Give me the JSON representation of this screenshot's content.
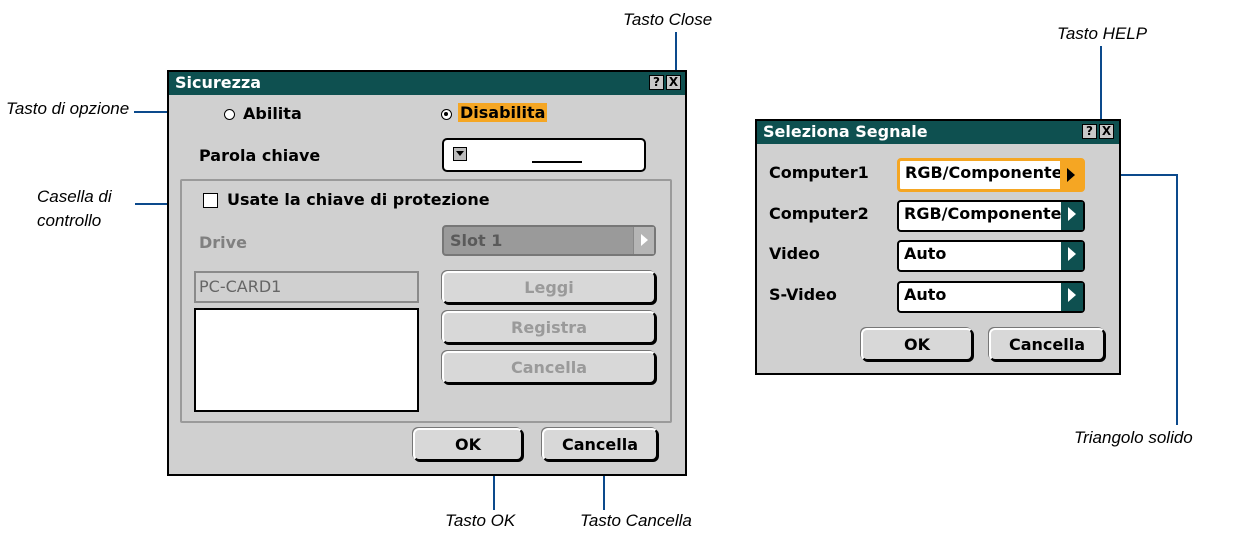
{
  "callouts": {
    "tasto_close": "Tasto Close",
    "tasto_help": "Tasto HELP",
    "tasto_opzione": "Tasto di opzione",
    "casella_line1": "Casella di",
    "casella_line2": "controllo",
    "triangolo": "Triangolo solido",
    "tasto_ok": "Tasto OK",
    "tasto_cancella": "Tasto Cancella"
  },
  "sicurezza": {
    "title": "Sicurezza",
    "help_glyph": "?",
    "close_glyph": "X",
    "radio_enable": "Abilita",
    "radio_disable": "Disabilita",
    "selected_radio": "Disabilita",
    "keyword_label": "Parola chiave",
    "keyword_value": "",
    "checkbox_label": "Usate la chiave di protezione",
    "checkbox_checked": false,
    "drive_label": "Drive",
    "drive_value": "Slot 1",
    "card_name": "PC-CARD1",
    "read_button": "Leggi",
    "register_button": "Registra",
    "delete_button": "Cancella",
    "ok_button": "OK",
    "cancel_button": "Cancella"
  },
  "seleziona": {
    "title": "Seleziona Segnale",
    "help_glyph": "?",
    "close_glyph": "X",
    "rows": [
      {
        "label": "Computer1",
        "value": "RGB/Componente"
      },
      {
        "label": "Computer2",
        "value": "RGB/Componente"
      },
      {
        "label": "Video",
        "value": "Auto"
      },
      {
        "label": "S-Video",
        "value": "Auto"
      }
    ],
    "ok_button": "OK",
    "cancel_button": "Cancella"
  },
  "colors": {
    "titlebar": "#0e5050",
    "highlight": "#f5a623",
    "callout_line": "#0c4a8c",
    "dialog_bg": "#d0d0d0"
  }
}
